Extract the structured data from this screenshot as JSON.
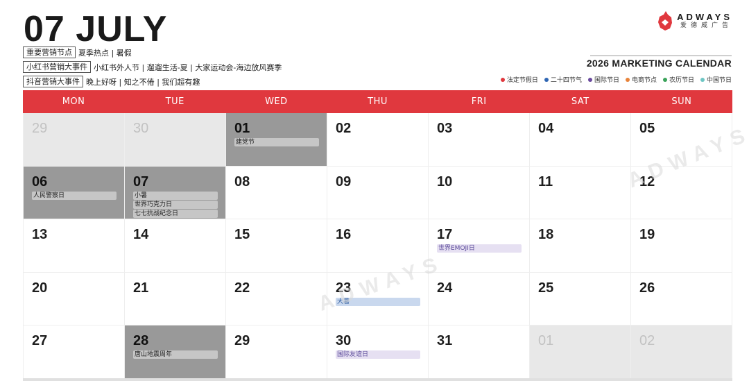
{
  "header": {
    "title": "07 JULY",
    "categories": [
      {
        "label": "重要营销节点",
        "text": "夏季热点 | 暑假"
      },
      {
        "label": "小红书营销大事件",
        "text": "小红书外人节 | 遛遛生活-夏 | 大家运动会-海边放风赛季"
      },
      {
        "label": "抖音营销大事件",
        "text": "晚上好呀 | 知之不倦 | 我们超有趣"
      }
    ]
  },
  "brand": {
    "name": "ADWAYS",
    "sub": "爱德威广告"
  },
  "calendar_title": "2026 MARKETING CALENDAR",
  "legend": [
    {
      "label": "法定节假日",
      "color": "#e0383e"
    },
    {
      "label": "二十四节气",
      "color": "#2f66b3"
    },
    {
      "label": "国际节日",
      "color": "#6a4a9e"
    },
    {
      "label": "电商节点",
      "color": "#e8833a"
    },
    {
      "label": "农历节日",
      "color": "#3aa35a"
    },
    {
      "label": "中国节日",
      "color": "#6ec6c4"
    }
  ],
  "weekdays": [
    "MON",
    "TUE",
    "WED",
    "THU",
    "FRI",
    "SAT",
    "SUN"
  ],
  "days": [
    {
      "num": "29",
      "type": "outside",
      "events": []
    },
    {
      "num": "30",
      "type": "outside",
      "events": []
    },
    {
      "num": "01",
      "type": "holiday",
      "events": [
        {
          "text": "建党节",
          "kind": "default"
        }
      ]
    },
    {
      "num": "02",
      "type": "normal",
      "events": []
    },
    {
      "num": "03",
      "type": "normal",
      "events": []
    },
    {
      "num": "04",
      "type": "normal",
      "events": []
    },
    {
      "num": "05",
      "type": "normal",
      "events": []
    },
    {
      "num": "06",
      "type": "holiday",
      "events": [
        {
          "text": "人民警察日",
          "kind": "default"
        }
      ]
    },
    {
      "num": "07",
      "type": "holiday",
      "events": [
        {
          "text": "小暑",
          "kind": "default"
        },
        {
          "text": "世界巧克力日",
          "kind": "default"
        },
        {
          "text": "七七抗战纪念日",
          "kind": "default"
        }
      ]
    },
    {
      "num": "08",
      "type": "normal",
      "events": []
    },
    {
      "num": "09",
      "type": "normal",
      "events": []
    },
    {
      "num": "10",
      "type": "normal",
      "events": []
    },
    {
      "num": "11",
      "type": "normal",
      "events": []
    },
    {
      "num": "12",
      "type": "normal",
      "events": []
    },
    {
      "num": "13",
      "type": "normal",
      "events": []
    },
    {
      "num": "14",
      "type": "normal",
      "events": []
    },
    {
      "num": "15",
      "type": "normal",
      "events": []
    },
    {
      "num": "16",
      "type": "normal",
      "events": []
    },
    {
      "num": "17",
      "type": "normal",
      "events": [
        {
          "text": "世界EMOJI日",
          "kind": "intl"
        }
      ]
    },
    {
      "num": "18",
      "type": "normal",
      "events": []
    },
    {
      "num": "19",
      "type": "normal",
      "events": []
    },
    {
      "num": "20",
      "type": "normal",
      "events": []
    },
    {
      "num": "21",
      "type": "normal",
      "events": []
    },
    {
      "num": "22",
      "type": "normal",
      "events": []
    },
    {
      "num": "23",
      "type": "normal",
      "events": [
        {
          "text": "大暑",
          "kind": "solar"
        }
      ]
    },
    {
      "num": "24",
      "type": "normal",
      "events": []
    },
    {
      "num": "25",
      "type": "normal",
      "events": []
    },
    {
      "num": "26",
      "type": "normal",
      "events": []
    },
    {
      "num": "27",
      "type": "normal",
      "events": []
    },
    {
      "num": "28",
      "type": "holiday",
      "events": [
        {
          "text": "唐山地震周年",
          "kind": "default"
        }
      ]
    },
    {
      "num": "29",
      "type": "normal",
      "events": []
    },
    {
      "num": "30",
      "type": "normal",
      "events": [
        {
          "text": "国际友谊日",
          "kind": "intl"
        }
      ]
    },
    {
      "num": "31",
      "type": "normal",
      "events": []
    },
    {
      "num": "01",
      "type": "outside",
      "events": []
    },
    {
      "num": "02",
      "type": "outside",
      "events": []
    }
  ]
}
